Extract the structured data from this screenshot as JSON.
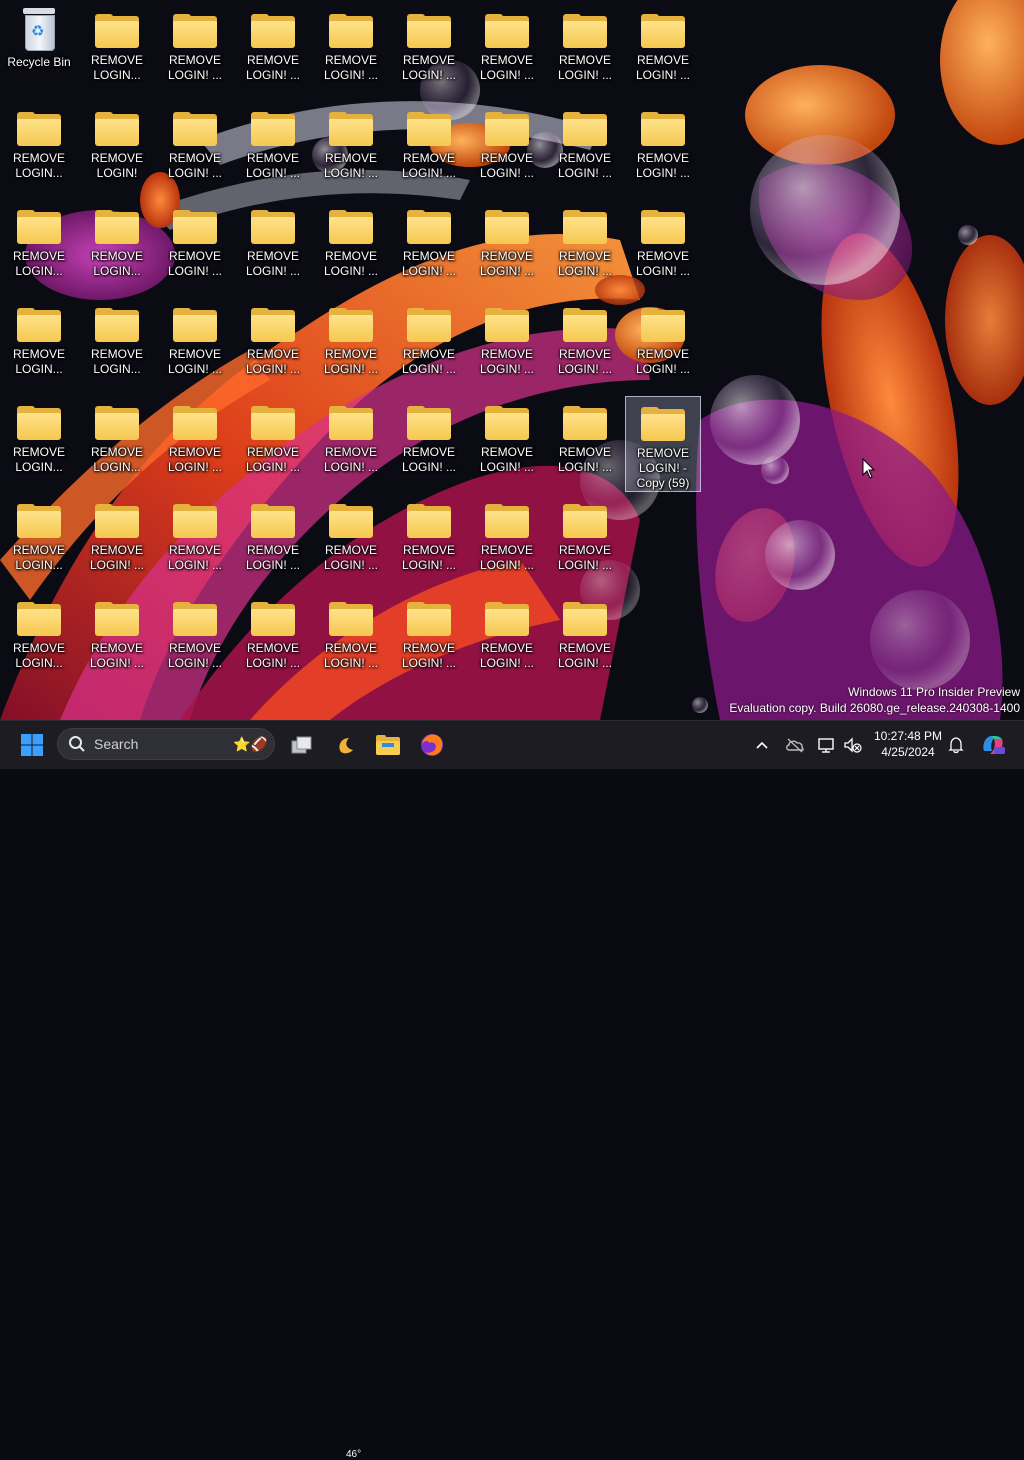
{
  "desktop": {
    "recycle_bin_label": "Recycle Bin",
    "folders": [
      [
        "REMOVE LOGIN...",
        "REMOVE LOGIN! ...",
        "REMOVE LOGIN! ...",
        "REMOVE LOGIN! ...",
        "REMOVE LOGIN! ...",
        "REMOVE LOGIN! ...",
        "REMOVE LOGIN! ...",
        "REMOVE LOGIN! ..."
      ],
      [
        "REMOVE LOGIN...",
        "REMOVE LOGIN!",
        "REMOVE LOGIN! ...",
        "REMOVE LOGIN! ...",
        "REMOVE LOGIN! ...",
        "REMOVE LOGIN! ...",
        "REMOVE LOGIN! ...",
        "REMOVE LOGIN! ...",
        "REMOVE LOGIN! ..."
      ],
      [
        "REMOVE LOGIN...",
        "REMOVE LOGIN...",
        "REMOVE LOGIN! ...",
        "REMOVE LOGIN! ...",
        "REMOVE LOGIN! ...",
        "REMOVE LOGIN! ...",
        "REMOVE LOGIN! ...",
        "REMOVE LOGIN! ...",
        "REMOVE LOGIN! ..."
      ],
      [
        "REMOVE LOGIN...",
        "REMOVE LOGIN...",
        "REMOVE LOGIN! ...",
        "REMOVE LOGIN! ...",
        "REMOVE LOGIN! ...",
        "REMOVE LOGIN! ...",
        "REMOVE LOGIN! ...",
        "REMOVE LOGIN! ...",
        "REMOVE LOGIN! ..."
      ],
      [
        "REMOVE LOGIN...",
        "REMOVE LOGIN...",
        "REMOVE LOGIN! ...",
        "REMOVE LOGIN! ...",
        "REMOVE LOGIN! ...",
        "REMOVE LOGIN! ...",
        "REMOVE LOGIN! ...",
        "REMOVE LOGIN! ...",
        "REMOVE LOGIN! - Copy (59)"
      ],
      [
        "REMOVE LOGIN...",
        "REMOVE LOGIN! ...",
        "REMOVE LOGIN! ...",
        "REMOVE LOGIN! ...",
        "REMOVE LOGIN! ...",
        "REMOVE LOGIN! ...",
        "REMOVE LOGIN! ...",
        "REMOVE LOGIN! ..."
      ],
      [
        "REMOVE LOGIN...",
        "REMOVE LOGIN! ...",
        "REMOVE LOGIN! ...",
        "REMOVE LOGIN! ...",
        "REMOVE LOGIN! ...",
        "REMOVE LOGIN! ...",
        "REMOVE LOGIN! ...",
        "REMOVE LOGIN! ..."
      ]
    ],
    "selected_folder": "REMOVE LOGIN! - Copy (59)",
    "watermark_line1": "Windows 11 Pro Insider Preview",
    "watermark_line2": "Evaluation copy. Build 26080.ge_release.240308-1400"
  },
  "taskbar": {
    "search_placeholder": "Search",
    "weather_temp": "46°",
    "clock_time": "10:27:48 PM",
    "clock_date": "4/25/2024",
    "icons": [
      "start-icon",
      "search-icon",
      "task-view-icon",
      "weather-icon",
      "file-explorer-icon",
      "firefox-icon",
      "show-hidden-icons-chevron",
      "onedrive-icon",
      "network-icon",
      "volume-muted-icon",
      "notification-bell-icon",
      "copilot-icon"
    ]
  },
  "colors": {
    "taskbar_bg": "#1c1c22",
    "folder_yellow": "#f5c84f",
    "start_blue": "#3aa0ff"
  }
}
